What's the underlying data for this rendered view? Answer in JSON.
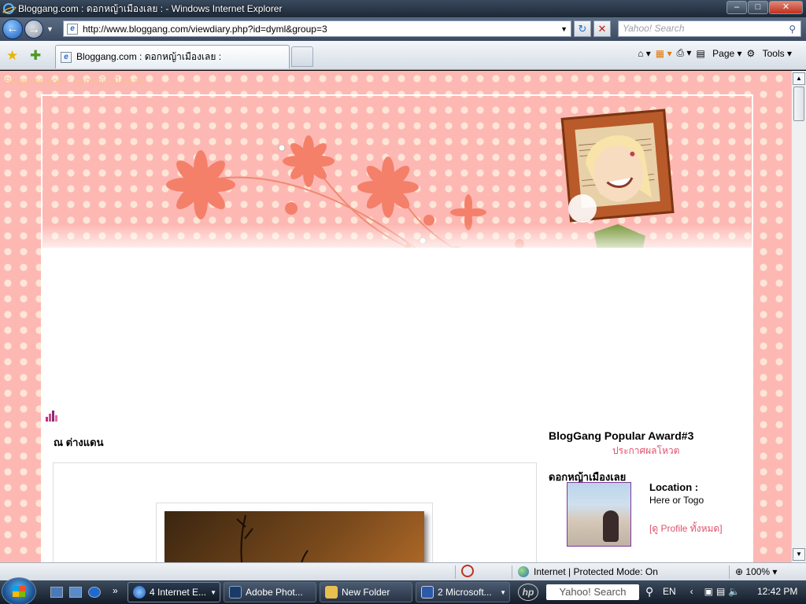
{
  "window": {
    "title": "Bloggang.com : ดอกหญ้าเมืองเลย : - Windows Internet Explorer",
    "minimize_glyph": "–",
    "maximize_glyph": "□",
    "close_glyph": "✕"
  },
  "address_bar": {
    "url": "http://www.bloggang.com/viewdiary.php?id=dyml&group=3",
    "search_placeholder": "Yahoo! Search",
    "back_glyph": "←",
    "forward_glyph": "→",
    "refresh_glyph": "↻",
    "stop_glyph": "✕"
  },
  "tabs": [
    {
      "label": "Bloggang.com : ดอกหญ้าเมืองเลย :"
    }
  ],
  "command_bar": {
    "page_label": "Page",
    "tools_label": "Tools"
  },
  "page": {
    "blog_header_text": "Bloggang.com : ดอกหญ้าเมืองเลย",
    "section_title": "ณ ต่างแดน",
    "award_title": "BlogGang Popular Award#3",
    "award_link": "ประกาศผลโหวต",
    "owner_name": "ดอกหญ้าเมืองเลย",
    "location_label": "Location :",
    "location_value": "Here or Togo",
    "profile_link": "[ดู Profile ทั้งหมด]"
  },
  "status_bar": {
    "zone": "Internet | Protected Mode: On",
    "zoom": "100%"
  },
  "taskbar": {
    "buttons": [
      {
        "label": "4 Internet E...",
        "active": true
      },
      {
        "label": "Adobe Phot...",
        "active": false
      },
      {
        "label": "New Folder",
        "active": false
      },
      {
        "label": "2 Microsoft...",
        "active": false
      }
    ],
    "search_text": "Yahoo! Search",
    "language": "EN",
    "clock": "12:42 PM"
  },
  "colors": {
    "pink_bg": "#fdb8b4",
    "dot": "#fde6d8",
    "link_red": "#e0506a"
  }
}
